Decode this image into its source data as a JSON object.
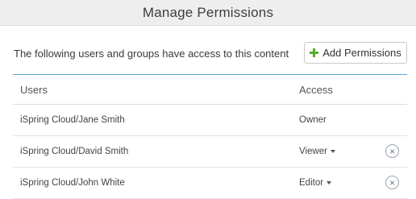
{
  "dialog": {
    "title": "Manage Permissions"
  },
  "intro_text": "The following users and groups have access to this content",
  "add_button": {
    "label": "Add Permissions",
    "icon": "plus-icon",
    "icon_color": "#5aaa2b"
  },
  "table": {
    "headers": {
      "users": "Users",
      "access": "Access"
    },
    "rows": [
      {
        "user": "iSpring Cloud/Jane Smith",
        "access": "Owner",
        "has_dropdown": false,
        "removable": false
      },
      {
        "user": "iSpring Cloud/David Smith",
        "access": "Viewer",
        "has_dropdown": true,
        "removable": true
      },
      {
        "user": "iSpring Cloud/John White",
        "access": "Editor",
        "has_dropdown": true,
        "removable": true
      }
    ]
  },
  "colors": {
    "header_rule": "#5aa7d8",
    "titlebar_bg": "#eeeeee"
  }
}
